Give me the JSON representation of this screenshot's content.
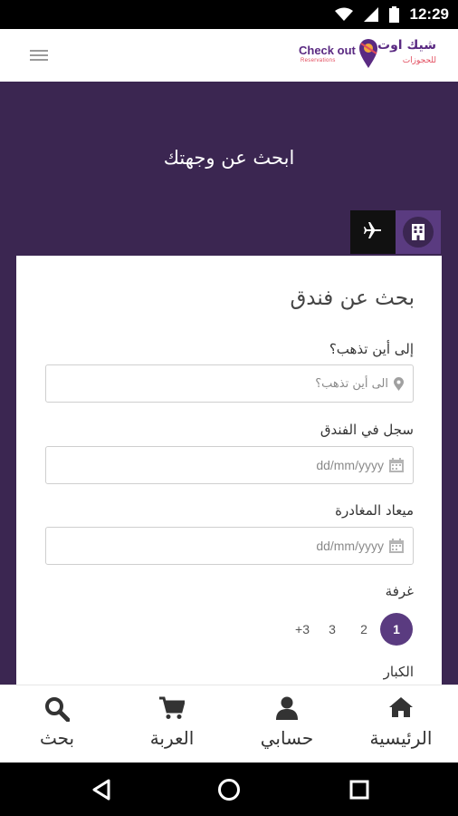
{
  "status_bar": {
    "time": "12:29",
    "icons": [
      "wifi-icon",
      "signal-icon",
      "battery-icon"
    ]
  },
  "app_bar": {
    "menu_icon": "hamburger-menu-icon",
    "logo": {
      "en_text": "Check out",
      "en_sub": "Reservations",
      "ar_text": "شيك اوت",
      "ar_sub": "للحجوزات",
      "colors": {
        "primary": "#5a2a82",
        "accent": "#e24a5c"
      }
    }
  },
  "hero": {
    "title": "ابحث عن وجهتك",
    "background": "#3b2651"
  },
  "search_tabs": [
    {
      "name": "hotel",
      "icon": "hotel-icon",
      "active": true
    },
    {
      "name": "flight",
      "icon": "airplane-icon",
      "active": false
    }
  ],
  "hotel_search": {
    "title": "بحث عن فندق",
    "destination": {
      "label": "إلى أين تذهب؟",
      "placeholder": "الى أين تذهب؟",
      "icon": "location-pin-icon"
    },
    "check_in": {
      "label": "سجل في الفندق",
      "placeholder": "dd/mm/yyyy",
      "icon": "calendar-icon"
    },
    "check_out": {
      "label": "ميعاد المغادرة",
      "placeholder": "dd/mm/yyyy",
      "icon": "calendar-icon"
    },
    "rooms": {
      "label": "غرفة",
      "options": [
        "1",
        "2",
        "3",
        "+3"
      ],
      "selected": "1"
    },
    "adults": {
      "label": "الكبار"
    }
  },
  "bottom_nav": {
    "items": [
      {
        "label": "الرئيسية",
        "icon": "home-icon"
      },
      {
        "label": "حسابي",
        "icon": "user-icon"
      },
      {
        "label": "العربة",
        "icon": "cart-icon"
      },
      {
        "label": "بحث",
        "icon": "search-icon"
      }
    ]
  },
  "system_nav": {
    "buttons": [
      "back-icon",
      "home-circle-icon",
      "recents-icon"
    ]
  },
  "colors": {
    "accent": "#5a3b80",
    "hero_bg": "#3b2651",
    "tab_dark": "#111111"
  }
}
